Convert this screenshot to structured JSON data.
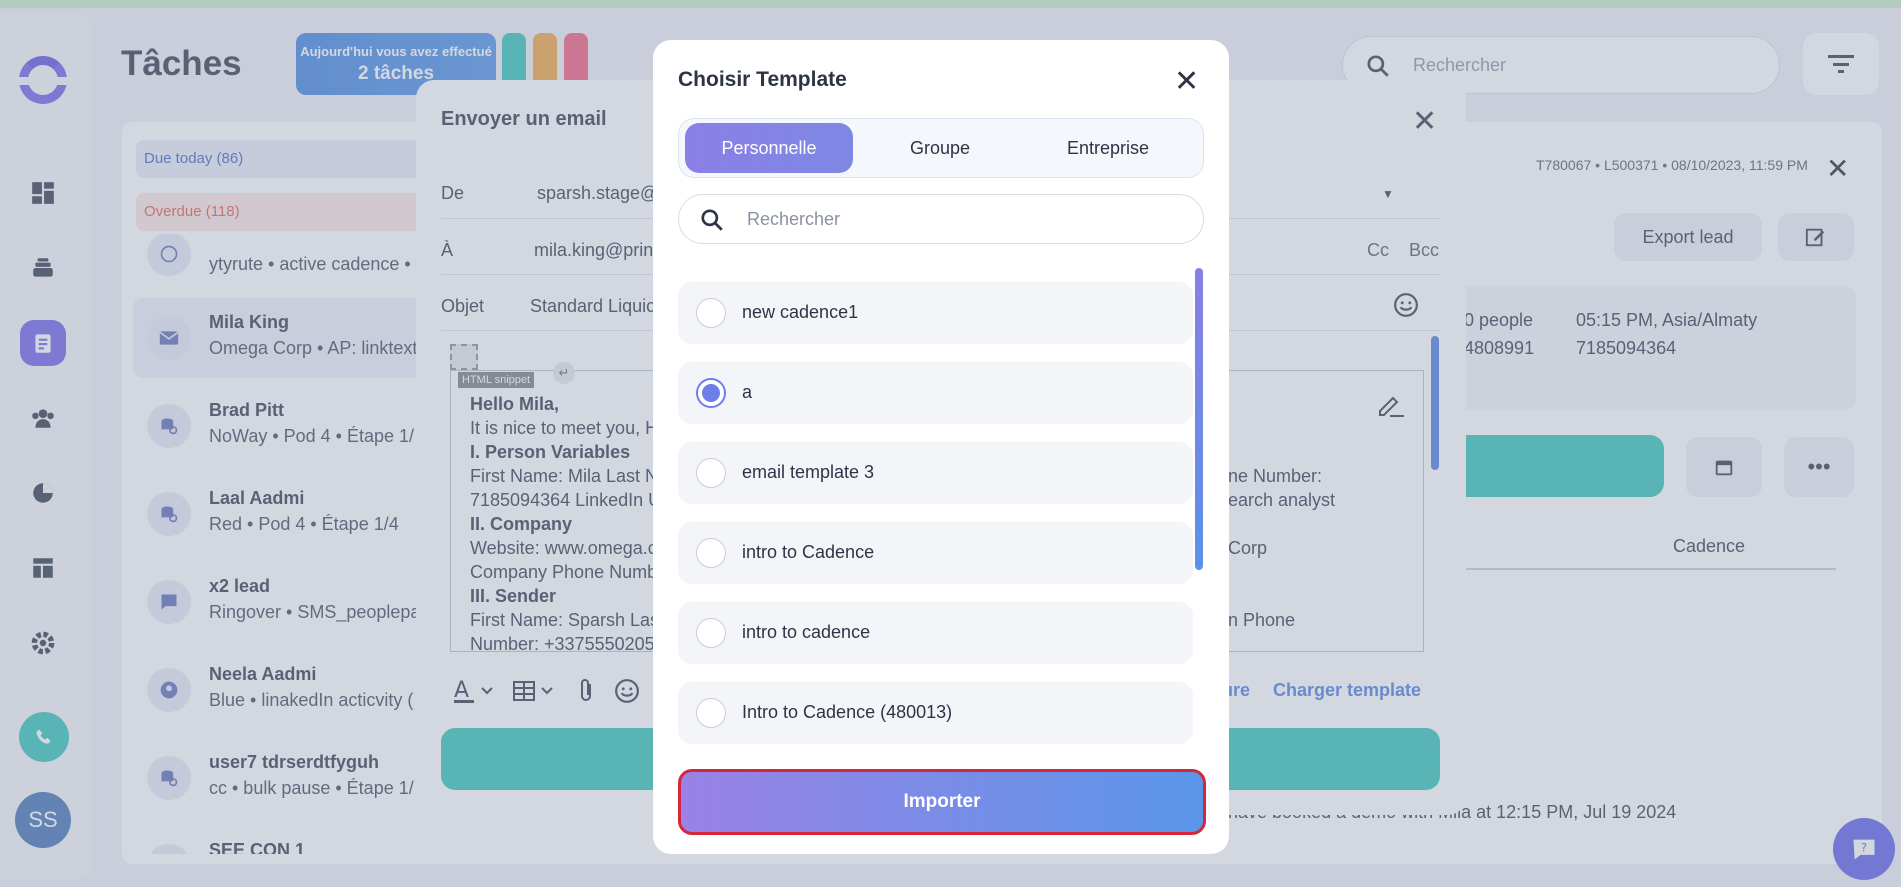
{
  "app": {
    "page_title": "Tâches",
    "banner_line1": "Aujourd'hui vous avez effectué",
    "banner_line2": "2 tâches",
    "search_placeholder": "Rechercher",
    "avatar_initials": "SS",
    "colors": {
      "accent": "#6d5fe8",
      "teal": "#2ec4b6",
      "danger": "#e05a40",
      "link": "#4a7be0"
    }
  },
  "tasks": {
    "due_today": "Due today (86)",
    "overdue": "Overdue (118)",
    "items": [
      {
        "name": "",
        "sub": "ytyrute • active cadence •",
        "icon": "whatsapp-icon"
      },
      {
        "name": "Mila King",
        "sub": "Omega Corp • AP: linktext",
        "icon": "mail-icon"
      },
      {
        "name": "Brad Pitt",
        "sub": "NoWay • Pod 4 • Étape 1/",
        "icon": "search-db-icon"
      },
      {
        "name": "Laal Aadmi",
        "sub": "Red • Pod 4 • Étape 1/4",
        "icon": "search-db-icon"
      },
      {
        "name": "x2 lead",
        "sub": "Ringover • SMS_peoplepa",
        "icon": "chat-icon"
      },
      {
        "name": "Neela Aadmi",
        "sub": "Blue • linakedIn acticvity (",
        "icon": "person-icon"
      },
      {
        "name": "user7 tdrserdtfyguh",
        "sub": "cc • bulk pause • Étape 1/",
        "icon": "search-db-icon"
      },
      {
        "name": "SEE CON 1",
        "sub": "",
        "icon": "search-db-icon"
      }
    ]
  },
  "lead_panel": {
    "meta": "T780067 • L500371 • 08/10/2023, 11:59 PM",
    "export_label": "Export lead",
    "people": "0 people",
    "timezone": "05:15 PM, Asia/Almaty",
    "phone1": "4808991",
    "phone2": "7185094364",
    "cadence_header": "Cadence",
    "activity": "have booked a demo with Mila at 12:15 PM, Jul 19 2024"
  },
  "email": {
    "title": "Envoyer un email",
    "from_label": "De",
    "from_value": "sparsh.stage@",
    "to_label": "À",
    "to_value": "mila.king@prin",
    "cc": "Cc",
    "bcc": "Bcc",
    "subject_label": "Objet",
    "subject_value": "Standard Liquic",
    "snippet_tag": "HTML snippet",
    "body": {
      "l1": "Hello Mila,",
      "l2": "It is nice to meet you, H",
      "l3": "I. Person Variables",
      "l4": "First Name: Mila Last N",
      "l5": "7185094364 LinkedIn U",
      "l6": "II. Company",
      "l7": "Website: www.omega.c",
      "l8": "Company Phone Numb",
      "l9": "III. Sender",
      "l10": "First Name: Sparsh Las",
      "l11": "Number: +3375550205"
    },
    "body_right": {
      "r1": "ne Number:",
      "r2": "earch analyst",
      "r3": "Corp",
      "r4": "n Phone"
    },
    "link_partial": "ure",
    "link_load": "Charger template"
  },
  "template_modal": {
    "title": "Choisir Template",
    "tabs": [
      "Personnelle",
      "Groupe",
      "Entreprise"
    ],
    "active_tab": "Personnelle",
    "search_placeholder": "Rechercher",
    "items": [
      {
        "label": "new cadence1",
        "selected": false
      },
      {
        "label": "a",
        "selected": true
      },
      {
        "label": "email template 3",
        "selected": false
      },
      {
        "label": "intro to Cadence",
        "selected": false
      },
      {
        "label": "intro to cadence",
        "selected": false
      },
      {
        "label": "Intro to Cadence (480013)",
        "selected": false
      }
    ],
    "import_label": "Importer"
  }
}
